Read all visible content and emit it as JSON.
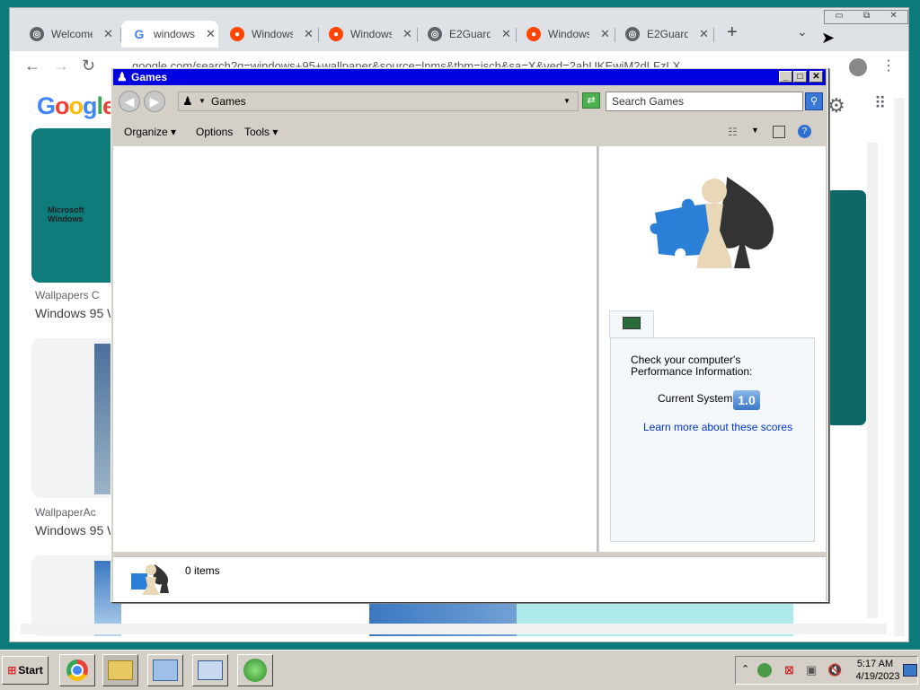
{
  "browser": {
    "tabs": [
      {
        "title": "Welcome",
        "icon": "globe-icon"
      },
      {
        "title": "windows",
        "icon": "google-icon",
        "active": true
      },
      {
        "title": "Windows",
        "icon": "reddit-icon"
      },
      {
        "title": "Windows",
        "icon": "reddit-icon"
      },
      {
        "title": "E2Guard",
        "icon": "globe-icon"
      },
      {
        "title": "Windows",
        "icon": "reddit-icon"
      },
      {
        "title": "E2Guard",
        "icon": "globe-icon"
      }
    ],
    "new_tab": "+",
    "url": "google.com/search?q=windows+95+wallpaper&source=lnms&tbm=isch&sa=X&ved=2ahUKEwjM2dLFzLX"
  },
  "google": {
    "logo": [
      "G",
      "o",
      "o",
      "g",
      "l",
      "e"
    ],
    "results": [
      {
        "source": "Wallpapers C",
        "title": "Windows 95 W"
      },
      {
        "source": "WallpaperAc",
        "title": "Windows 95 W"
      }
    ],
    "card_text": "Microsoft Windows"
  },
  "games_window": {
    "title": "Games",
    "address": "Games",
    "search_placeholder": "Search Games",
    "commands": {
      "organize": "Organize",
      "options": "Options",
      "tools": "Tools"
    },
    "perf": {
      "heading": "Check your computer's Performance Information:",
      "current_label": "Current System",
      "score": "1.0",
      "link": "Learn more about these scores"
    },
    "status": {
      "count": "0 items"
    }
  },
  "taskbar": {
    "start": "Start",
    "time": "5:17 AM",
    "date": "4/19/2023"
  },
  "colors": {
    "desktop": "#0c7a7a",
    "titlebar": "#0000e0",
    "taskbar": "#d4d0c8"
  }
}
